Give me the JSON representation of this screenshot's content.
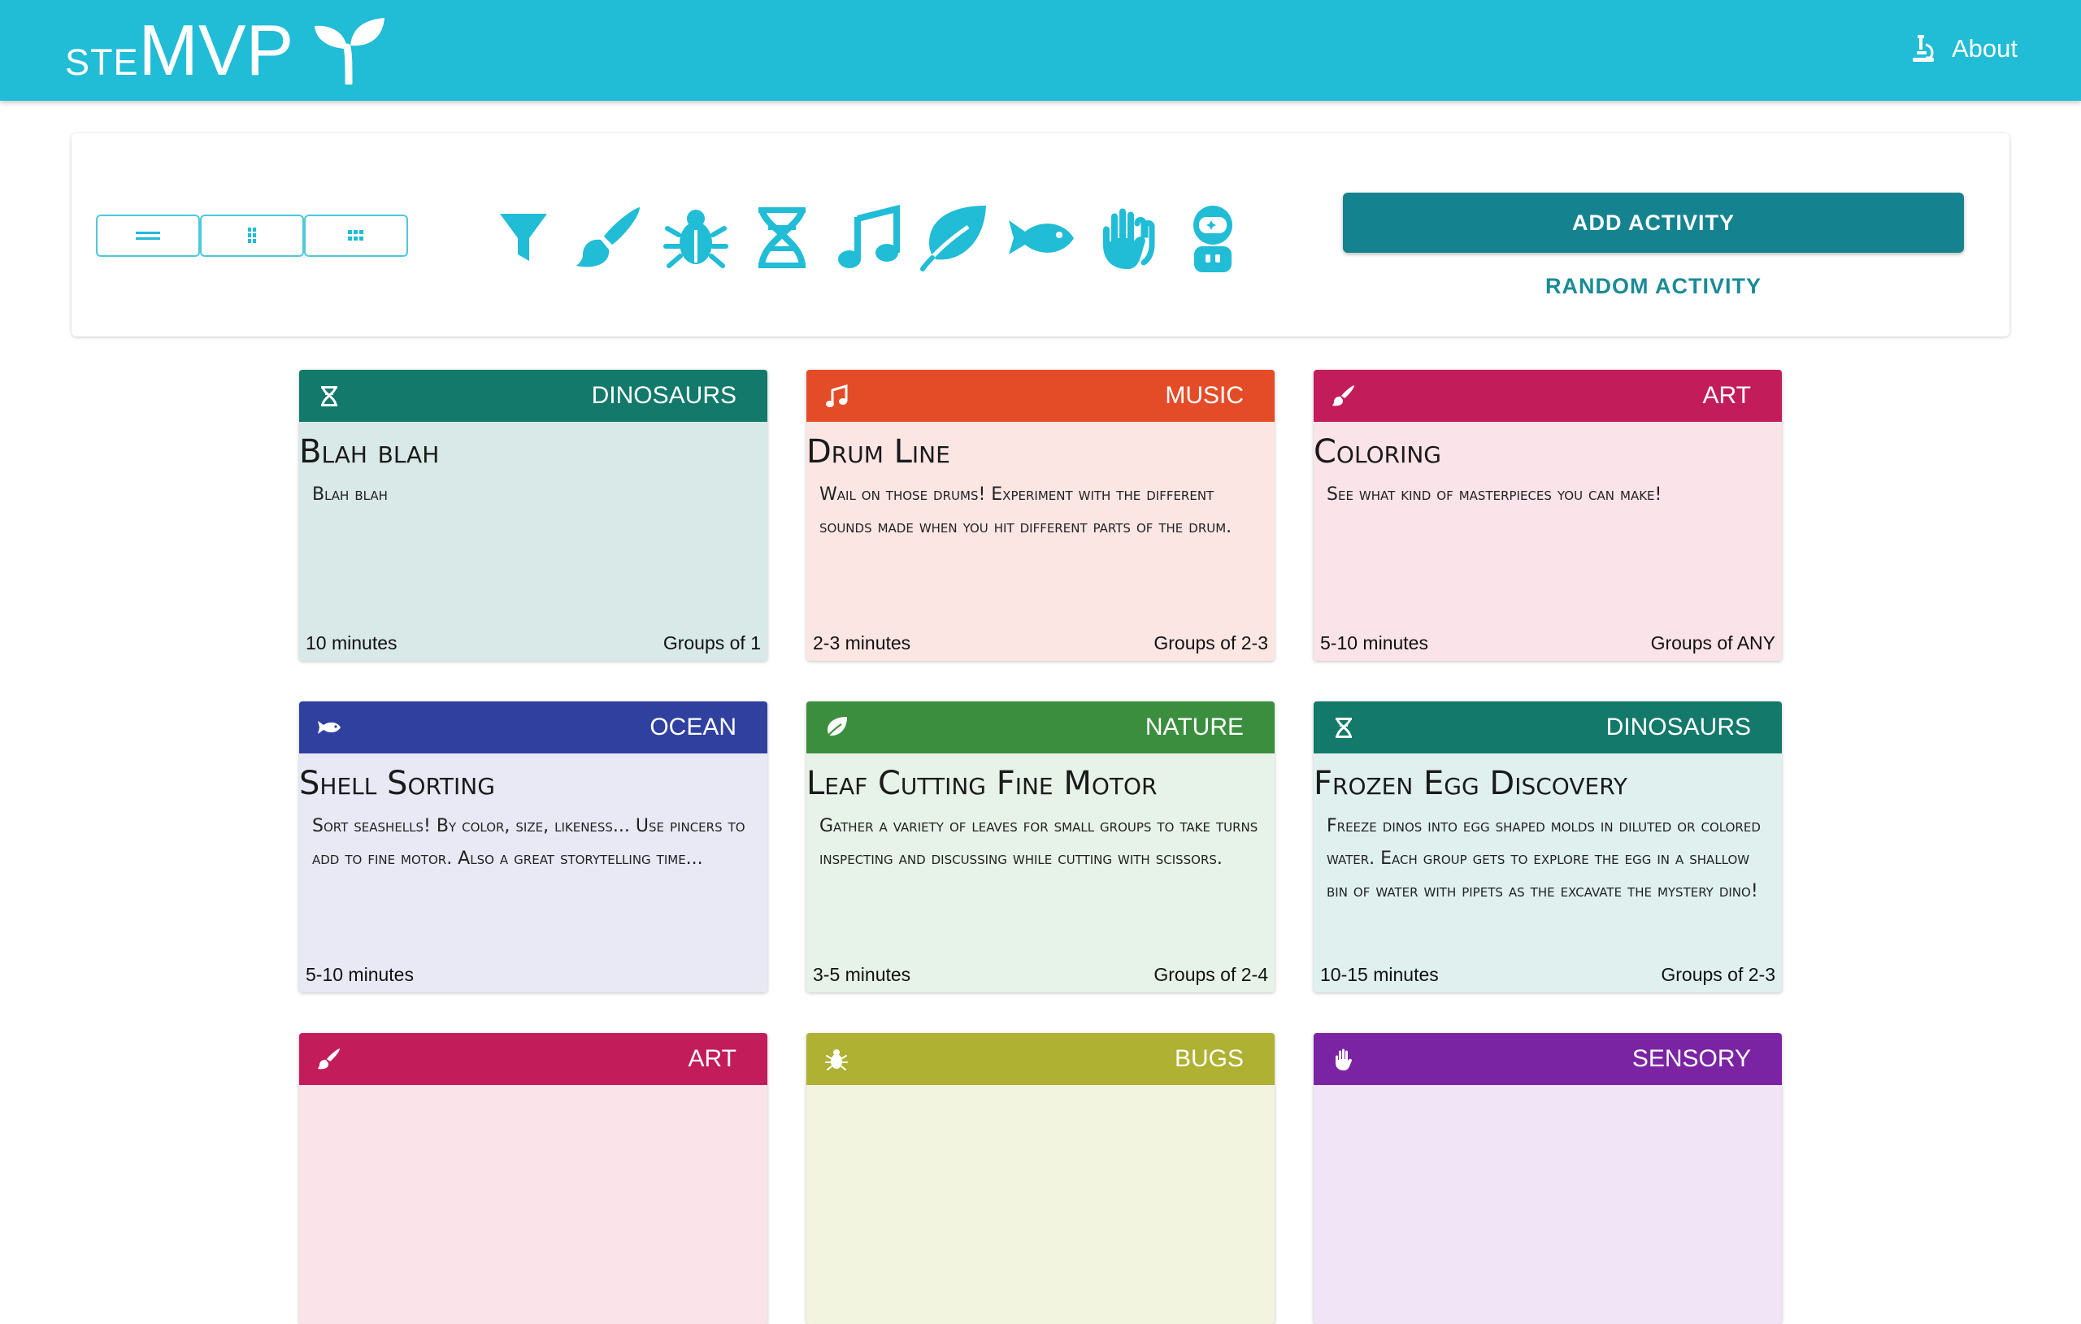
{
  "header": {
    "brand_small": "ste",
    "brand_big": "MVP",
    "about_label": "About"
  },
  "toolbar": {
    "view_buttons": [
      "list-view",
      "medium-grid-view",
      "small-grid-view"
    ],
    "filter_icons": [
      "filter-icon",
      "art-brush-icon",
      "bug-icon",
      "dna-icon",
      "music-note-icon",
      "leaf-icon",
      "fish-icon",
      "hands-icon",
      "astronaut-icon"
    ],
    "add_activity_label": "ADD ACTIVITY",
    "random_activity_label": "RANDOM ACTIVITY"
  },
  "cards": [
    {
      "category": "DINOSAURS",
      "icon": "dna-icon",
      "title": "Blah blah",
      "description": "Blah blah",
      "duration": "10 minutes",
      "groups": "Groups of 1",
      "head_color": "#12796b",
      "body_color": "#d8e9e7"
    },
    {
      "category": "MUSIC",
      "icon": "music-note-icon",
      "title": "Drum Line",
      "description": "Wail on those drums! Experiment with the different sounds made when you hit different parts of the drum.",
      "duration": "2-3 minutes",
      "groups": "Groups of 2-3",
      "head_color": "#e44c28",
      "body_color": "#fbe6e4"
    },
    {
      "category": "ART",
      "icon": "art-brush-icon",
      "title": "Coloring",
      "description": "See what kind of masterpieces you can make!",
      "duration": "5-10 minutes",
      "groups": "Groups of ANY",
      "head_color": "#c31c5b",
      "body_color": "#fbe3ea"
    },
    {
      "category": "OCEAN",
      "icon": "fish-icon",
      "title": "Shell Sorting",
      "description": "Sort seashells! By color, size, likeness... Use pincers to add to fine motor. Also a great storytelling time...",
      "duration": "5-10 minutes",
      "groups": "",
      "head_color": "#30409f",
      "body_color": "#e8e9f5"
    },
    {
      "category": "NATURE",
      "icon": "leaf-icon",
      "title": "Leaf Cutting Fine Motor",
      "description": "Gather a variety of leaves for small groups to take turns inspecting and discussing while cutting with scissors.",
      "duration": "3-5 minutes",
      "groups": "Groups of 2-4",
      "head_color": "#3c8e3f",
      "body_color": "#e7f2e8"
    },
    {
      "category": "DINOSAURS",
      "icon": "dna-icon",
      "title": "Frozen Egg Discovery",
      "description": "Freeze dinos into egg shaped molds in diluted or colored water. Each group gets to explore the egg in a shallow bin of water with pipets as the excavate the mystery dino!",
      "duration": "10-15 minutes",
      "groups": "Groups of 2-3",
      "head_color": "#12796b",
      "body_color": "#dff0ef"
    },
    {
      "category": "ART",
      "icon": "art-brush-icon",
      "title": "",
      "description": "",
      "duration": "",
      "groups": "",
      "head_color": "#c31c5b",
      "body_color": "#fbe3ea"
    },
    {
      "category": "BUGS",
      "icon": "bug-icon",
      "title": "",
      "description": "",
      "duration": "",
      "groups": "",
      "head_color": "#aeb132",
      "body_color": "#f3f4df"
    },
    {
      "category": "SENSORY",
      "icon": "hands-icon",
      "title": "",
      "description": "",
      "duration": "",
      "groups": "",
      "head_color": "#7b24a3",
      "body_color": "#f1e4f6"
    }
  ]
}
